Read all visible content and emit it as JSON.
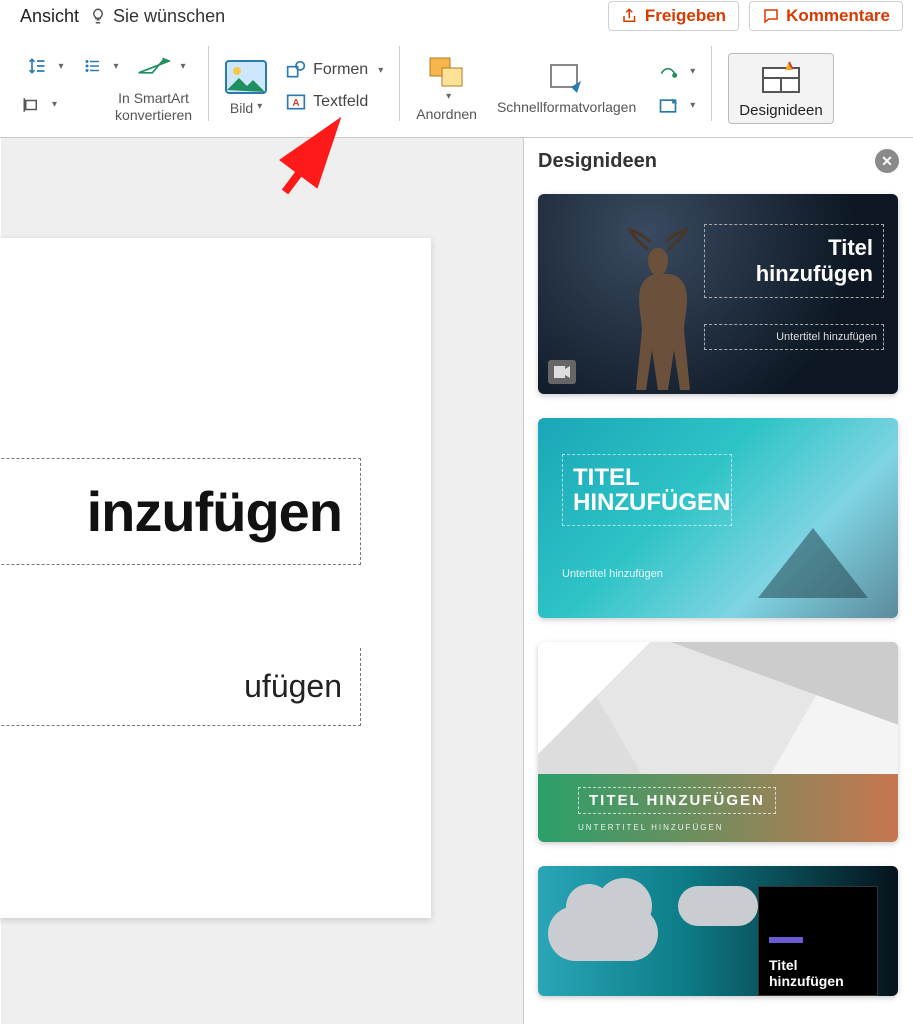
{
  "topbar": {
    "view_tab": "Ansicht",
    "wish": "Sie wünschen",
    "share": "Freigeben",
    "comments": "Kommentare"
  },
  "ribbon": {
    "smartart": "In SmartArt\nkonvertieren",
    "image": "Bild",
    "shapes": "Formen",
    "textbox": "Textfeld",
    "arrange": "Anordnen",
    "quickstyles": "Schnellformatvorlagen",
    "designideas": "Designideen"
  },
  "slide": {
    "title": "inzufügen",
    "subtitle": "ufügen"
  },
  "pane": {
    "title": "Designideen",
    "ideas": [
      {
        "title": "Titel hinzufügen",
        "subtitle": "Untertitel hinzufügen"
      },
      {
        "title": "TITEL HINZUFÜGEN",
        "subtitle": "Untertitel hinzufügen"
      },
      {
        "title": "TITEL HINZUFÜGEN",
        "subtitle": "UNTERTITEL HINZUFÜGEN"
      },
      {
        "title": "Titel hinzufügen",
        "subtitle": ""
      }
    ]
  }
}
